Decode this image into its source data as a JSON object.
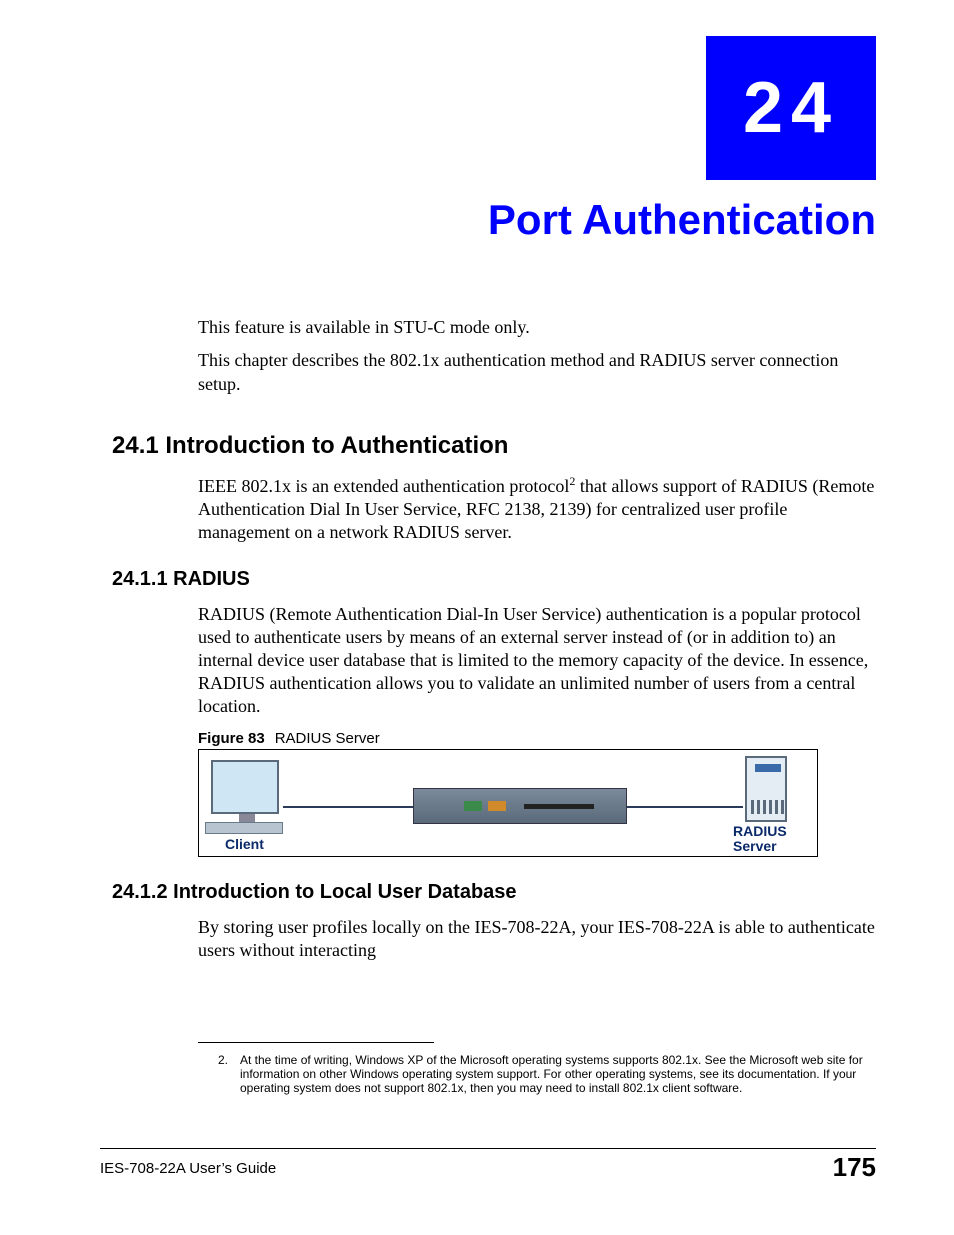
{
  "chapter": {
    "number": "24",
    "title": "Port Authentication"
  },
  "intro": {
    "p1": "This feature is available in STU-C mode only.",
    "p2": "This chapter describes the 802.1x authentication method and RADIUS server connection setup."
  },
  "section_24_1": {
    "heading": "24.1  Introduction to Authentication",
    "p_pre": "IEEE 802.1x is an extended authentication protocol",
    "sup": "2",
    "p_post": " that allows support of RADIUS (Remote Authentication Dial In User Service, RFC 2138, 2139) for centralized user profile management on a network RADIUS server."
  },
  "section_24_1_1": {
    "heading": "24.1.1  RADIUS",
    "p": "RADIUS (Remote Authentication Dial-In User Service) authentication is a popular protocol used to authenticate users by means of an external server instead of (or in addition to) an internal device user database that is limited to the memory capacity of the device. In essence, RADIUS authentication allows you to validate an unlimited number of users from a central location."
  },
  "figure": {
    "label_bold": "Figure 83",
    "label_rest": "RADIUS Server",
    "client_label": "Client",
    "server_label_l1": "RADIUS",
    "server_label_l2": "Server"
  },
  "section_24_1_2": {
    "heading": "24.1.2  Introduction to Local User Database",
    "p": "By storing user profiles locally on the IES-708-22A, your IES-708-22A is able to authenticate users without interacting"
  },
  "footnote": {
    "num": "2.",
    "text": "At the time of writing, Windows XP of the Microsoft operating systems supports 802.1x. See the Microsoft web site for information on other Windows operating system support. For other operating systems, see its documentation. If your operating system does not support 802.1x, then you may need to install 802.1x client software."
  },
  "footer": {
    "left": "IES-708-22A User’s Guide",
    "right": "175"
  }
}
